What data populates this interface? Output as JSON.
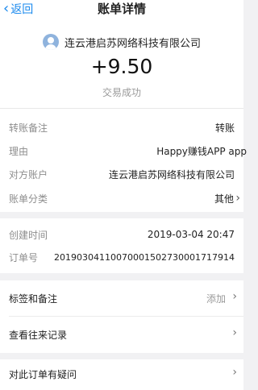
{
  "nav": {
    "back": "返回",
    "title": "账单详情"
  },
  "header": {
    "merchant": "连云港启苏网络科技有限公司",
    "amount": "+9.50",
    "status": "交易成功"
  },
  "details": [
    {
      "label": "转账备注",
      "value": "转账"
    },
    {
      "label": "理由",
      "value": "Happy赚钱APP app"
    },
    {
      "label": "对方账户",
      "value": "连云港启苏网络科技有限公司"
    },
    {
      "label": "账单分类",
      "value": "其他"
    }
  ],
  "meta": [
    {
      "label": "创建时间",
      "value": "2019-03-04 20:47"
    },
    {
      "label": "订单号",
      "value": "20190304110070001502730001717914"
    }
  ],
  "actions": {
    "tags": {
      "label": "标签和备注",
      "value": "添加"
    },
    "history": {
      "label": "查看往来记录"
    },
    "question": {
      "label": "对此订单有疑问"
    }
  },
  "icons": {
    "back": "chevron-left-icon",
    "arrow": "chevron-right-icon",
    "avatar": "user-avatar-icon"
  },
  "colors": {
    "link": "#1a89ee",
    "background": "#f1f1f3"
  }
}
